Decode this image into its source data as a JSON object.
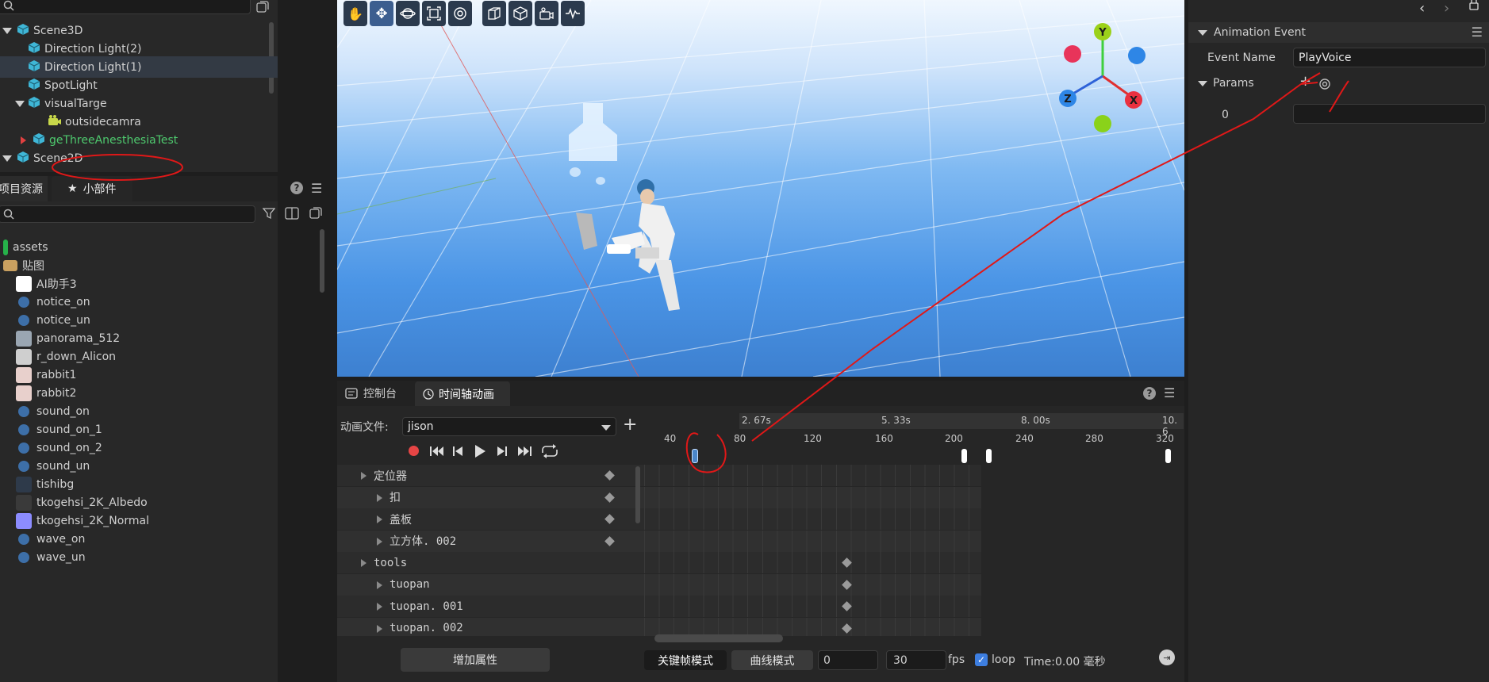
{
  "hierarchy": {
    "items": [
      {
        "label": "Scene3D"
      },
      {
        "label": "Direction Light(2)"
      },
      {
        "label": "Direction Light(1)"
      },
      {
        "label": "SpotLight"
      },
      {
        "label": "visualTarge"
      },
      {
        "label": "outsidecamra"
      },
      {
        "label": "geThreeAnesthesiaTest"
      },
      {
        "label": "Scene2D"
      }
    ]
  },
  "assets_panel": {
    "tab_project": "项目资源",
    "tab_widgets": "小部件",
    "items": [
      {
        "label": "assets",
        "icon": "folder-icon"
      },
      {
        "label": "贴图",
        "icon": "folder-icon"
      },
      {
        "label": "AI助手3",
        "icon": "image-thumb-icon"
      },
      {
        "label": "notice_on",
        "icon": "image-thumb-icon"
      },
      {
        "label": "notice_un",
        "icon": "image-thumb-icon"
      },
      {
        "label": "panorama_512",
        "icon": "image-thumb-icon"
      },
      {
        "label": "r_down_Alicon",
        "icon": "image-thumb-icon"
      },
      {
        "label": "rabbit1",
        "icon": "image-thumb-icon"
      },
      {
        "label": "rabbit2",
        "icon": "image-thumb-icon"
      },
      {
        "label": "sound_on",
        "icon": "image-thumb-icon"
      },
      {
        "label": "sound_on_1",
        "icon": "image-thumb-icon"
      },
      {
        "label": "sound_on_2",
        "icon": "image-thumb-icon"
      },
      {
        "label": "sound_un",
        "icon": "image-thumb-icon"
      },
      {
        "label": "tishibg",
        "icon": "image-thumb-icon"
      },
      {
        "label": "tkogehsi_2K_Albedo",
        "icon": "image-thumb-icon"
      },
      {
        "label": "tkogehsi_2K_Normal",
        "icon": "image-thumb-icon"
      },
      {
        "label": "wave_on",
        "icon": "image-thumb-icon"
      },
      {
        "label": "wave_un",
        "icon": "image-thumb-icon"
      }
    ]
  },
  "gizmo": {
    "y": "Y",
    "x": "X",
    "z": "Z"
  },
  "timeline": {
    "tab_console": "控制台",
    "tab_timeline": "时间轴动画",
    "anim_file_label": "动画文件:",
    "anim_file_value": "jison",
    "time_labels": [
      "2. 67s",
      "5. 33s",
      "8. 00s",
      "10. 6"
    ],
    "frame_labels": [
      "40",
      "80",
      "120",
      "160",
      "200",
      "240",
      "280",
      "320"
    ],
    "tracks": [
      {
        "label": "定位器"
      },
      {
        "label": "扣"
      },
      {
        "label": "盖板"
      },
      {
        "label": "立方体. 002"
      },
      {
        "label": "tools"
      },
      {
        "label": "tuopan"
      },
      {
        "label": "tuopan. 001"
      },
      {
        "label": "tuopan. 002"
      }
    ],
    "add_property": "增加属性",
    "keyframe_mode": "关键帧模式",
    "curve_mode": "曲线模式",
    "frame_value": "0",
    "fps_value": "30",
    "fps_label": "fps",
    "loop_label": "loop",
    "time_readout": "Time:0.00 毫秒"
  },
  "inspector": {
    "section_title": "Animation Event",
    "event_name_label": "Event Name",
    "event_name_value": "PlayVoice",
    "params_label": "Params",
    "param_index": "0",
    "param_value": ""
  }
}
